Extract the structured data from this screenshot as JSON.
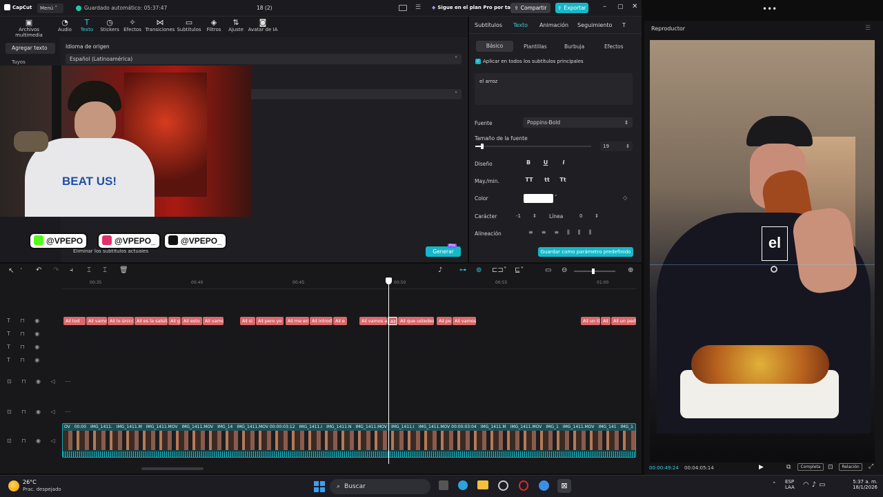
{
  "topbar": {
    "logo": "CapCut",
    "menu": "Menú",
    "autosave": "Guardado automático: 05:37:47",
    "project_title": "18 (2)",
    "promo": "Sigue en el plan Pro por tal",
    "share": "Compartir",
    "export": "Exportar"
  },
  "toolbar": [
    {
      "label": "Archivos multimedia",
      "icon": "media-icon"
    },
    {
      "label": "Audio",
      "icon": "audio-icon"
    },
    {
      "label": "Texto",
      "icon": "text-icon"
    },
    {
      "label": "Stickers",
      "icon": "stickers-icon"
    },
    {
      "label": "Efectos",
      "icon": "effects-icon"
    },
    {
      "label": "Transiciones",
      "icon": "transitions-icon"
    },
    {
      "label": "Subtítulos",
      "icon": "subtitles-icon"
    },
    {
      "label": "Filtros",
      "icon": "filters-icon"
    },
    {
      "label": "Ajuste",
      "icon": "adjust-icon"
    },
    {
      "label": "Avatar de IA",
      "icon": "avatar-icon"
    }
  ],
  "left": {
    "add_text": "Agregar texto",
    "yours": "Tuyos",
    "source_lang_label": "Idioma de origen",
    "source_lang_value": "Español (Latinoamérica)",
    "remove_subs": "Eliminar los subtítulos actuales",
    "generate": "Generar",
    "pro_badge": "Pro"
  },
  "overlay": {
    "shirt_text": "BEAT US!",
    "social": [
      {
        "handle": "@VPEPO",
        "color": "#53fc18"
      },
      {
        "handle": "@VPEPO_",
        "color": "#e1306c"
      },
      {
        "handle": "@VPEPO_",
        "color": "#111111"
      }
    ]
  },
  "right": {
    "tabs": [
      "Subtítulos",
      "Texto",
      "Animación",
      "Seguimiento",
      "T"
    ],
    "subtabs": [
      "Básico",
      "Plantillas",
      "Burbuja",
      "Efectos"
    ],
    "apply_all": "Aplicar en todos los subtítulos principales",
    "text_value": "el arroz",
    "font_label": "Fuente",
    "font_value": "Poppins-Bold",
    "size_label": "Tamaño de la fuente",
    "size_value": "19",
    "design_label": "Diseño",
    "case_label": "May./min.",
    "case_opts": [
      "TT",
      "tt",
      "Tt"
    ],
    "color_label": "Color",
    "char_label": "Carácter",
    "char_value": "-1",
    "line_label": "Línea",
    "line_value": "0",
    "align_label": "Alineación",
    "save_preset": "Guardar como parámetro predefinido",
    "size_fraction": 0.05
  },
  "player": {
    "title": "Reproductor",
    "caption": "el",
    "current": "00:00:49:24",
    "total": "00:04:05:14",
    "full": "Completa",
    "ratio": "Relación"
  },
  "timeline": {
    "ticks": [
      "00:35",
      "00:40",
      "00:45",
      "00:50",
      "00:55",
      "01:00"
    ],
    "text_clips": [
      "A‡ tod",
      "A‡ vamo",
      "A‡ lo únicc",
      "A‡ es la salsita",
      "A‡ g",
      "A‡ esto",
      "A‡ vamo",
      "A‡ si",
      "A‡ pero yo",
      "A‡ me en",
      "A‡ introd",
      "A‡ e",
      "A‡ vamos a",
      "A‡",
      "A‡ que ustedes",
      "A‡ pe",
      "A‡ vamos",
      "A‡ un ti",
      "A‡",
      "A‡ un ped"
    ],
    "video_labels": [
      "OV",
      "00:00",
      "IMG_1411.",
      "IMG_1411.M",
      "IMG_1411.MOV",
      "IMG_1411.MOV",
      "IMG_14",
      "IMG_1411.MOV  00:00:03:12",
      "IMG_1411.I",
      "IMG_1411.N",
      "IMG_1411.MOV",
      "IMG_1411.I",
      "IMG_1411.MOV  00:00:03:04",
      "IMG_1411.M",
      "IMG_1411.MOV",
      "IMG_1",
      "IMG_1411.MOV",
      "IMG_141",
      "IMG_1"
    ]
  },
  "taskbar": {
    "temp": "26°C",
    "weather": "Prac. despejado",
    "search": "Buscar",
    "lang1": "ESP",
    "lang2": "LAA",
    "time": "5:37 a. m.",
    "date": "18/1/2026"
  }
}
